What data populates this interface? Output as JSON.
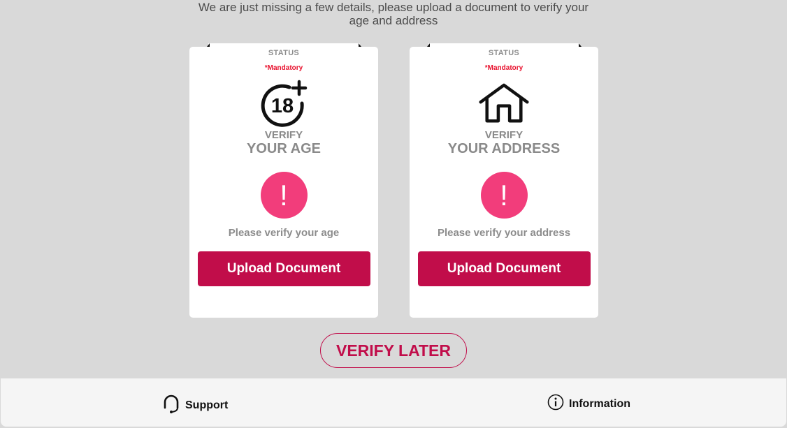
{
  "intro": {
    "line1": "We are just missing a few details, please upload a document to verify your",
    "line2": "age and address"
  },
  "cards": [
    {
      "status_label": "STATUS",
      "mandatory": "*Mandatory",
      "icon": "age-18-plus-icon",
      "verify_line1": "VERIFY",
      "verify_line2": "YOUR AGE",
      "alert_glyph": "!",
      "alert_message": "Please verify your age",
      "button_label": "Upload Document"
    },
    {
      "status_label": "STATUS",
      "mandatory": "*Mandatory",
      "icon": "house-icon",
      "verify_line1": "VERIFY",
      "verify_line2": "YOUR ADDRESS",
      "alert_glyph": "!",
      "alert_message": "Please verify your address",
      "button_label": "Upload Document"
    }
  ],
  "verify_later_label": "VERIFY LATER",
  "footer": {
    "support_label": "Support",
    "information_label": "Information"
  },
  "colors": {
    "brand": "#c10d4a",
    "alert": "#f23d7b",
    "mandatory": "#e8112d",
    "background": "#d9d9d9"
  }
}
